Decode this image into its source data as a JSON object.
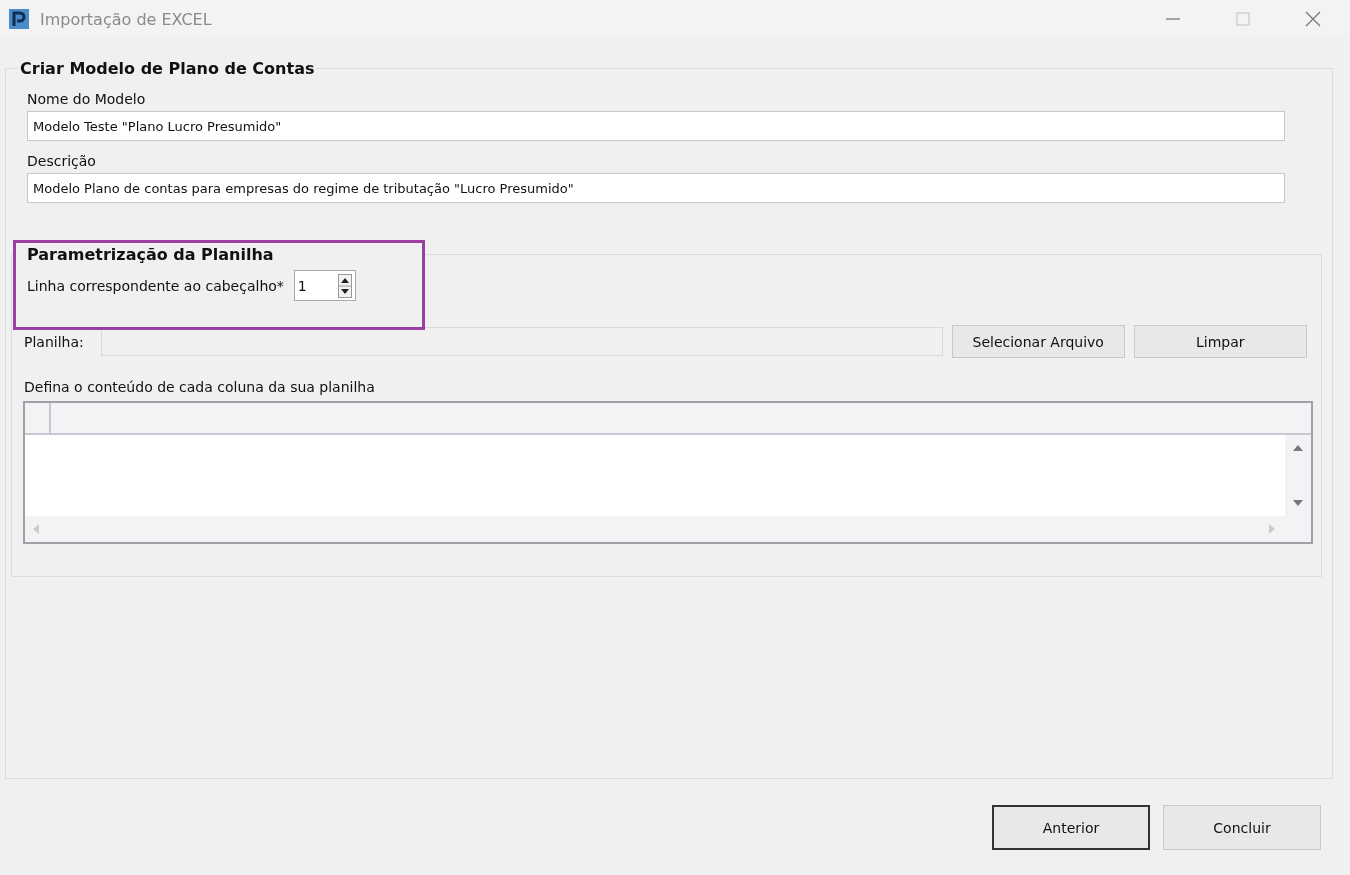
{
  "window": {
    "title": "Importação de EXCEL"
  },
  "form": {
    "title": "Criar Modelo de Plano de Contas",
    "fields": [
      {
        "label": "Nome do Modelo",
        "value": "Modelo Teste \"Plano Lucro Presumido\""
      },
      {
        "label": "Descrição",
        "value": "Modelo Plano de contas para empresas do regime de tributação \"Lucro Presumido\""
      }
    ]
  },
  "parametrization": {
    "title": "Parametrização da Planilha",
    "header_row": {
      "label": "Linha correspondente ao cabeçalho*",
      "value": "1"
    },
    "file": {
      "label": "Planilha:"
    },
    "buttons": [
      "Selecionar Arquivo",
      "Limpar"
    ],
    "grid_caption": "Defina o conteúdo de cada coluna da sua planilha"
  },
  "footer_buttons": [
    {
      "label": "Anterior",
      "default": true
    },
    {
      "label": "Concluir",
      "default": false
    }
  ]
}
